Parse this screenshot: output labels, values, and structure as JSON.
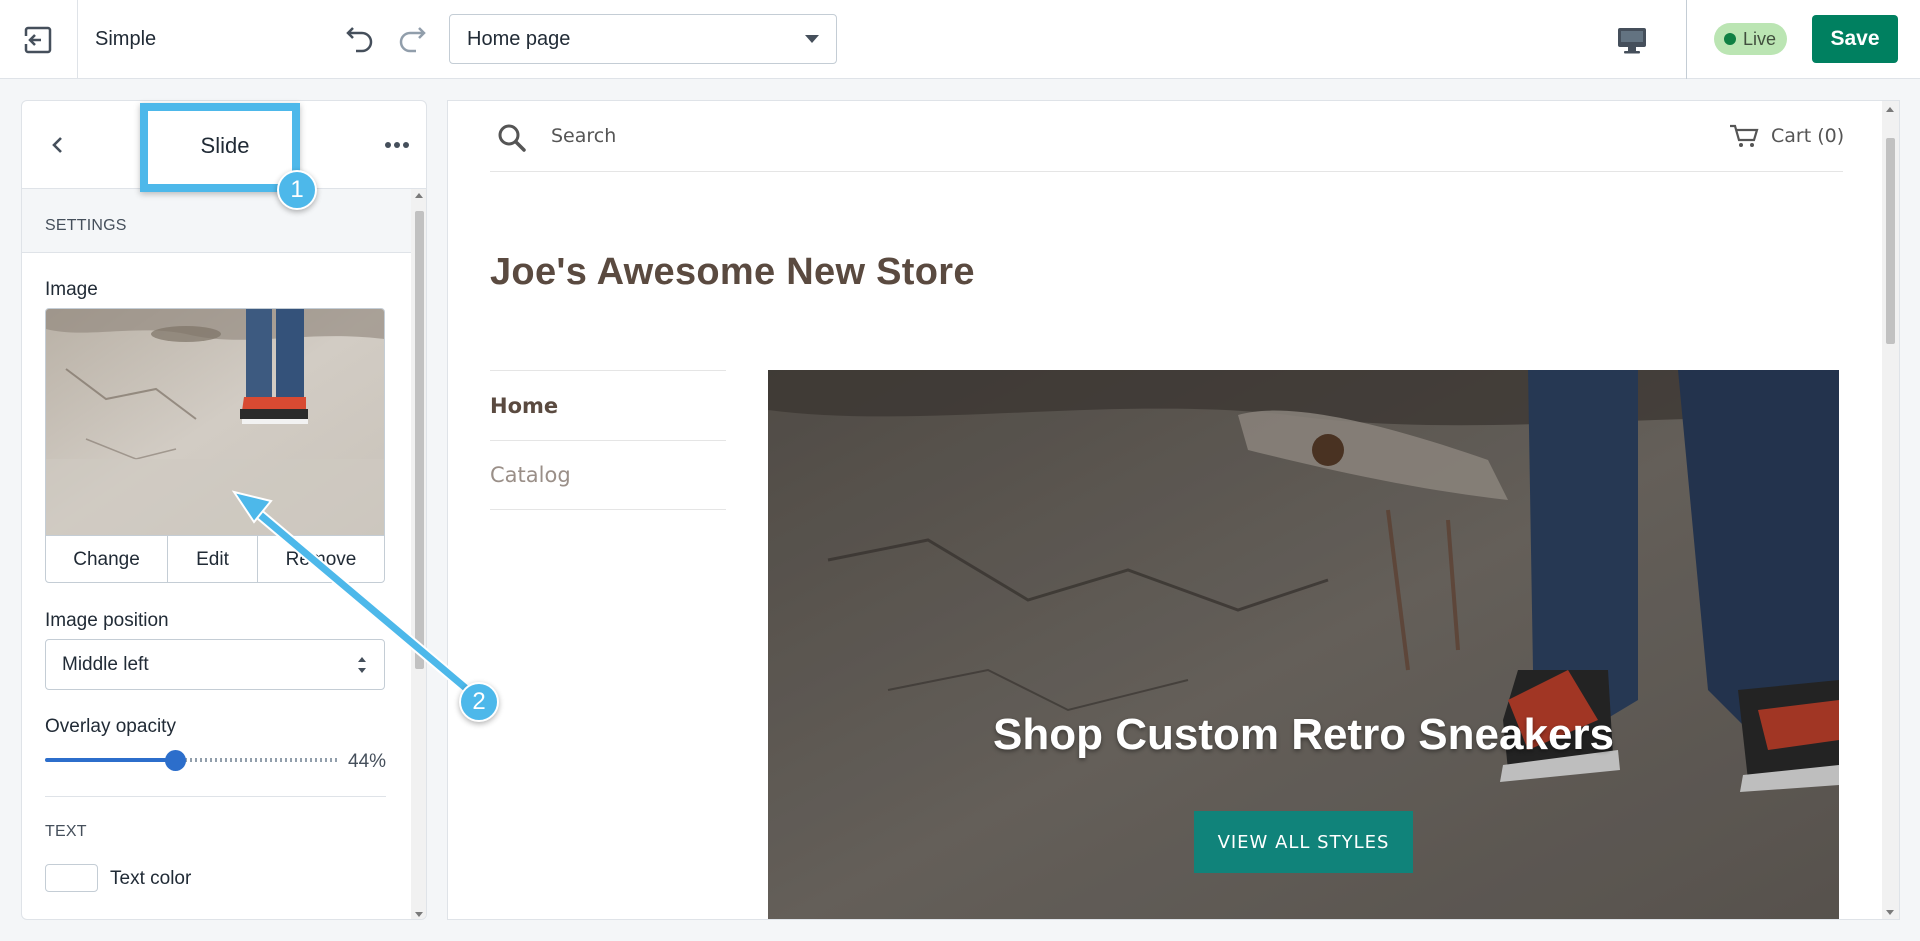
{
  "topbar": {
    "theme_name": "Simple",
    "page_select_value": "Home page",
    "live_label": "Live",
    "save_label": "Save"
  },
  "sidebar": {
    "title": "Slide",
    "settings_heading": "SETTINGS",
    "image_label": "Image",
    "image_buttons": [
      "Change",
      "Edit",
      "Remove"
    ],
    "image_position_label": "Image position",
    "image_position_value": "Middle left",
    "overlay_opacity_label": "Overlay opacity",
    "overlay_opacity_value": "44%",
    "overlay_opacity_fraction": 0.44,
    "text_heading": "TEXT",
    "text_color_label": "Text color"
  },
  "preview": {
    "search_label": "Search",
    "cart_label": "Cart (0)",
    "store_title": "Joe's Awesome New Store",
    "nav_items": [
      "Home",
      "Catalog"
    ],
    "hero_heading": "Shop Custom Retro Sneakers",
    "hero_button": "VIEW ALL STYLES"
  },
  "annotations": {
    "callout_1": "1",
    "callout_2": "2"
  },
  "colors": {
    "accent_blue": "#4db8ea",
    "save_green": "#008060",
    "hero_button": "#10837a",
    "live_badge": "#bbe5b3"
  }
}
